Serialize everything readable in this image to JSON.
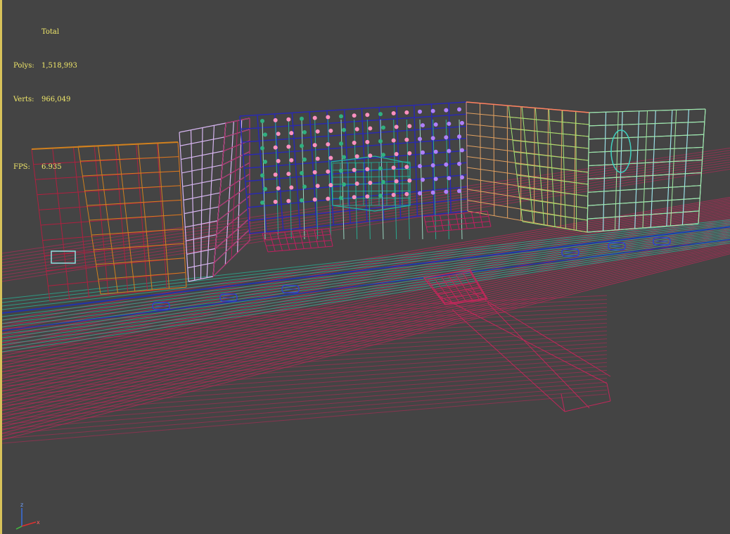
{
  "stats": {
    "header": "Total",
    "polys_label": "Polys:",
    "polys_value": "1,518,993",
    "verts_label": "Verts:",
    "verts_value": "966,049",
    "fps_label": "FPS:",
    "fps_value": "6.935"
  },
  "axis": {
    "z_label": "z",
    "x_label": "x"
  },
  "colors": {
    "background": "#444444",
    "stats_text": "#f2e96a",
    "frame_border": "#d8c25a",
    "road_magenta": "#c0285a",
    "road_teal": "#2aa98f",
    "road_blue": "#2233aa",
    "building_red": "#b02040",
    "building_orange": "#d0801e",
    "building_lavender": "#d6b5f0",
    "building_navy": "#2a2ab0",
    "building_green": "#7fd070",
    "building_cyan": "#8de0e0"
  }
}
